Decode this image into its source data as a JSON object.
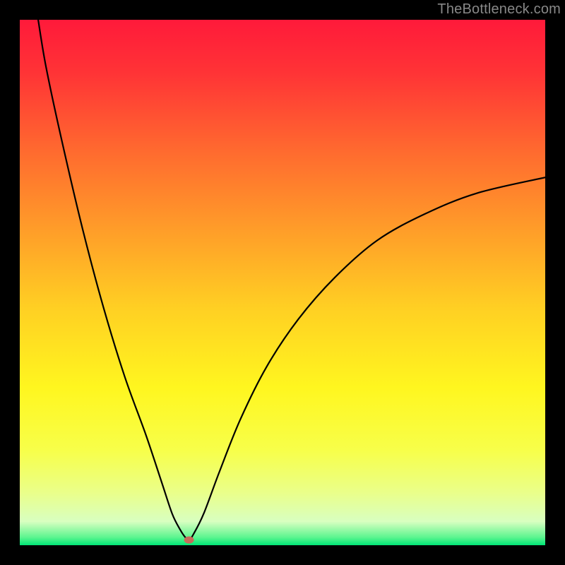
{
  "watermark": "TheBottleneck.com",
  "chart_data": {
    "type": "line",
    "title": "",
    "xlabel": "",
    "ylabel": "",
    "xlim": [
      0,
      100
    ],
    "ylim": [
      0,
      100
    ],
    "gradient_stops": [
      {
        "offset": 0.0,
        "color": "#ff1a3a"
      },
      {
        "offset": 0.1,
        "color": "#ff3336"
      },
      {
        "offset": 0.25,
        "color": "#ff6a2f"
      },
      {
        "offset": 0.4,
        "color": "#ff9d29"
      },
      {
        "offset": 0.55,
        "color": "#ffd023"
      },
      {
        "offset": 0.7,
        "color": "#fff61f"
      },
      {
        "offset": 0.82,
        "color": "#f7ff4a"
      },
      {
        "offset": 0.9,
        "color": "#eaff8a"
      },
      {
        "offset": 0.955,
        "color": "#d8ffc0"
      },
      {
        "offset": 0.985,
        "color": "#5cf58f"
      },
      {
        "offset": 1.0,
        "color": "#00e676"
      }
    ],
    "series": [
      {
        "name": "bottleneck-curve",
        "x": [
          3.5,
          5,
          8,
          12,
          16,
          20,
          24,
          27,
          29,
          30.5,
          31.5,
          32.2,
          33,
          35,
          38,
          42,
          47,
          53,
          60,
          68,
          77,
          87,
          100
        ],
        "y": [
          100,
          91,
          77,
          60,
          45,
          32,
          21,
          12,
          6,
          3,
          1.5,
          1,
          2,
          6,
          14,
          24,
          34,
          43,
          51,
          58,
          63,
          67,
          70
        ]
      }
    ],
    "marker": {
      "x": 32.2,
      "y": 1.0,
      "color": "#c96a5a",
      "rx": 7,
      "ry": 5
    },
    "curve_color": "#000000",
    "curve_width": 2.2
  }
}
